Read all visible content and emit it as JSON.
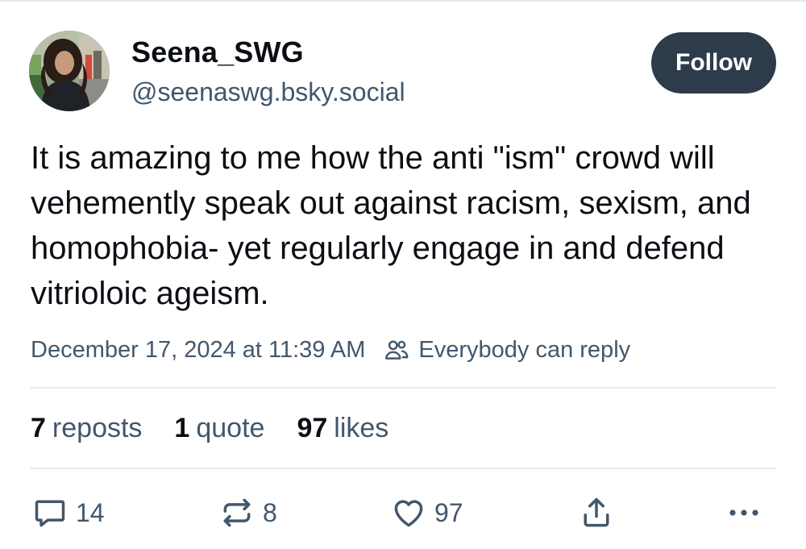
{
  "author": {
    "display_name": "Seena_SWG",
    "handle": "@seenaswg.bsky.social"
  },
  "follow_button_label": "Follow",
  "post": {
    "text": "It is amazing to me how the anti \"ism\" crowd will vehemently speak out against racism, sexism, and homophobia- yet regularly engage in and defend vitrioloic ageism.",
    "timestamp": "December 17, 2024 at 11:39 AM",
    "reply_setting": "Everybody can reply"
  },
  "stats": {
    "reposts_count": "7",
    "reposts_label": "reposts",
    "quotes_count": "1",
    "quotes_label": "quote",
    "likes_count": "97",
    "likes_label": "likes"
  },
  "actions": {
    "reply_count": "14",
    "repost_count": "8",
    "like_count": "97"
  },
  "icons": {
    "reply_setting": "people-icon",
    "reply": "speech-bubble-icon",
    "repost": "repost-arrows-icon",
    "like": "heart-icon",
    "share": "share-icon",
    "more": "more-dots-icon"
  },
  "colors": {
    "text_primary": "#0b0f14",
    "text_secondary": "#42576c",
    "follow_button_bg": "#2e3b4b",
    "divider": "#e6e9ee"
  }
}
